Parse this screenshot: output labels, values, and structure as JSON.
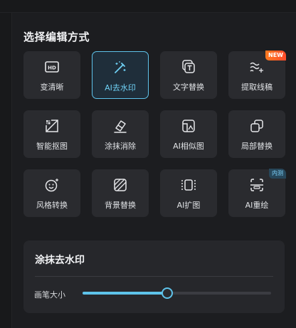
{
  "panel": {
    "title": "选择编辑方式"
  },
  "tools": [
    {
      "label": "变清晰",
      "icon": "hd-icon",
      "selected": false,
      "badge": ""
    },
    {
      "label": "AI去水印",
      "icon": "magic-wand-icon",
      "selected": true,
      "badge": ""
    },
    {
      "label": "文字替换",
      "icon": "text-replace-icon",
      "selected": false,
      "badge": ""
    },
    {
      "label": "提取线稿",
      "icon": "line-extract-icon",
      "selected": false,
      "badge": "NEW"
    },
    {
      "label": "智能抠图",
      "icon": "cutout-icon",
      "selected": false,
      "badge": ""
    },
    {
      "label": "涂抹消除",
      "icon": "eraser-icon",
      "selected": false,
      "badge": ""
    },
    {
      "label": "AI相似图",
      "icon": "similar-image-icon",
      "selected": false,
      "badge": ""
    },
    {
      "label": "局部替换",
      "icon": "partial-replace-icon",
      "selected": false,
      "badge": ""
    },
    {
      "label": "风格转换",
      "icon": "style-transfer-icon",
      "selected": false,
      "badge": ""
    },
    {
      "label": "背景替换",
      "icon": "background-replace-icon",
      "selected": false,
      "badge": ""
    },
    {
      "label": "AI扩图",
      "icon": "expand-image-icon",
      "selected": false,
      "badge": ""
    },
    {
      "label": "AI重绘",
      "icon": "redraw-icon",
      "selected": false,
      "badge": "内测"
    }
  ],
  "settings": {
    "title": "涂抹去水印",
    "brush_label": "画笔大小",
    "brush_size_fraction": 0.45
  },
  "colors": {
    "accent": "#5ec3ea",
    "badge_new": "#ff5a24",
    "badge_beta": "#27475a"
  }
}
